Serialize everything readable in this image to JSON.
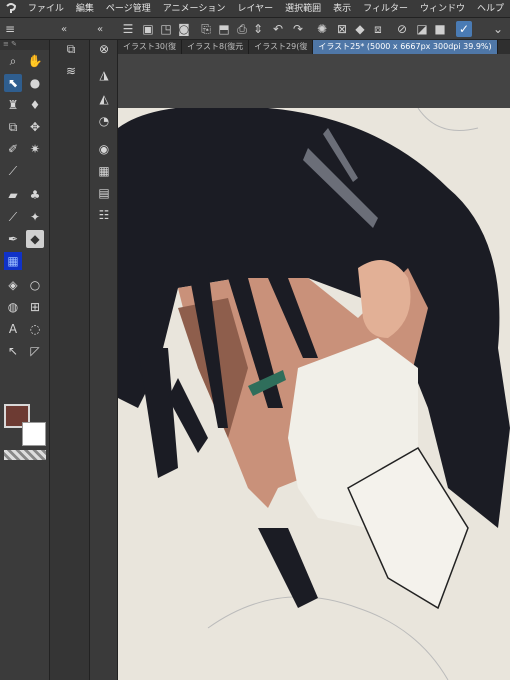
{
  "menubar": {
    "items": [
      "ファイル",
      "編集",
      "ページ管理",
      "アニメーション",
      "レイヤー",
      "選択範囲",
      "表示",
      "フィルター",
      "ウィンドウ",
      "ヘルプ"
    ]
  },
  "tabs": [
    {
      "label": "イラスト30(復"
    },
    {
      "label": "イラスト8(復元"
    },
    {
      "label": "イラスト29(復"
    },
    {
      "label": "イラスト25* (5000 x 6667px 300dpi 39.9%)"
    }
  ],
  "colors": {
    "main": "#6d3b33",
    "sub": "#ffffff",
    "accent": "#4f77a7"
  },
  "icons": {
    "toolbar": [
      "menu-icon",
      "new-icon",
      "open-icon",
      "save-icon",
      "export-icon",
      "undo-icon",
      "redo-icon",
      "loading-icon",
      "fill-icon",
      "transform-icon",
      "ruler-icon",
      "check-icon",
      "chevron-down-icon"
    ]
  }
}
